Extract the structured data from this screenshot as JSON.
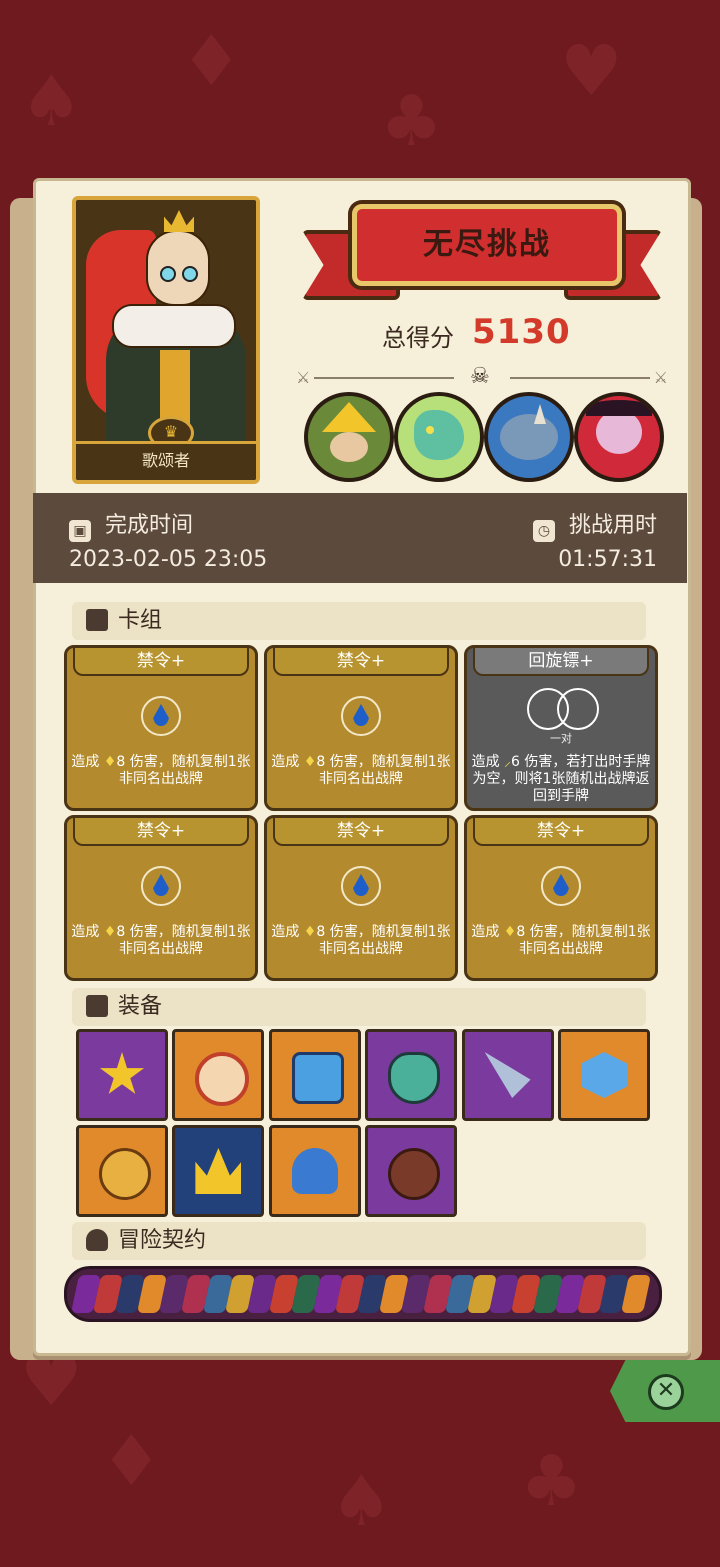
{
  "header": {
    "title": "无尽挑战",
    "score_label": "总得分",
    "score_value": "5130"
  },
  "hero": {
    "name": "歌颂者"
  },
  "info": {
    "finish_label": "完成时间",
    "finish_value": "2023-02-05 23:05",
    "duration_label": "挑战用时",
    "duration_value": "01:57:31"
  },
  "deck": {
    "label": "卡组",
    "cards": [
      {
        "name": "禁令+",
        "pre": "造成",
        "gem": "♦",
        "num": "8",
        "post": "伤害，随机复制1张非同名出战牌"
      },
      {
        "name": "禁令+",
        "pre": "造成",
        "gem": "♦",
        "num": "8",
        "post": "伤害，随机复制1张非同名出战牌"
      },
      {
        "name": "回旋镖+",
        "pair": "一对",
        "pre": "造成",
        "gem": "⸝",
        "num": "6",
        "post": "伤害，若打出时手牌为空，则将1张随机出战牌返回到手牌"
      },
      {
        "name": "禁令+",
        "pre": "造成",
        "gem": "♦",
        "num": "8",
        "post": "伤害，随机复制1张非同名出战牌"
      },
      {
        "name": "禁令+",
        "pre": "造成",
        "gem": "♦",
        "num": "8",
        "post": "伤害，随机复制1张非同名出战牌"
      },
      {
        "name": "禁令+",
        "pre": "造成",
        "gem": "♦",
        "num": "8",
        "post": "伤害，随机复制1张非同名出战牌"
      }
    ]
  },
  "equipment": {
    "label": "装备",
    "items": [
      {
        "icon": "sun-cup-emblem-icon",
        "bg": "#7b3a9e"
      },
      {
        "icon": "shield-ring-icon",
        "bg": "#e08a2c"
      },
      {
        "icon": "blue-cube-icon",
        "bg": "#e08a2c"
      },
      {
        "icon": "demon-mask-icon",
        "bg": "#7b3a9e"
      },
      {
        "icon": "drill-horn-icon",
        "bg": "#7b3a9e"
      },
      {
        "icon": "frost-badge-icon",
        "bg": "#e08a2c"
      },
      {
        "icon": "lion-ring-icon",
        "bg": "#e08a2c"
      },
      {
        "icon": "golden-crown-icon",
        "bg": "#22407a"
      },
      {
        "icon": "blue-mushroom-icon",
        "bg": "#e08a2c"
      },
      {
        "icon": "wooden-button-icon",
        "bg": "#7b3a9e"
      }
    ]
  },
  "contract": {
    "label": "冒险契约"
  },
  "colors": {
    "background": "#6e1a1e",
    "paper": "#f6efd9",
    "card_gold": "#b38a2e",
    "card_gray": "#5a5a5a",
    "score": "#d43a2a",
    "info_bar": "#5c4a3c"
  }
}
